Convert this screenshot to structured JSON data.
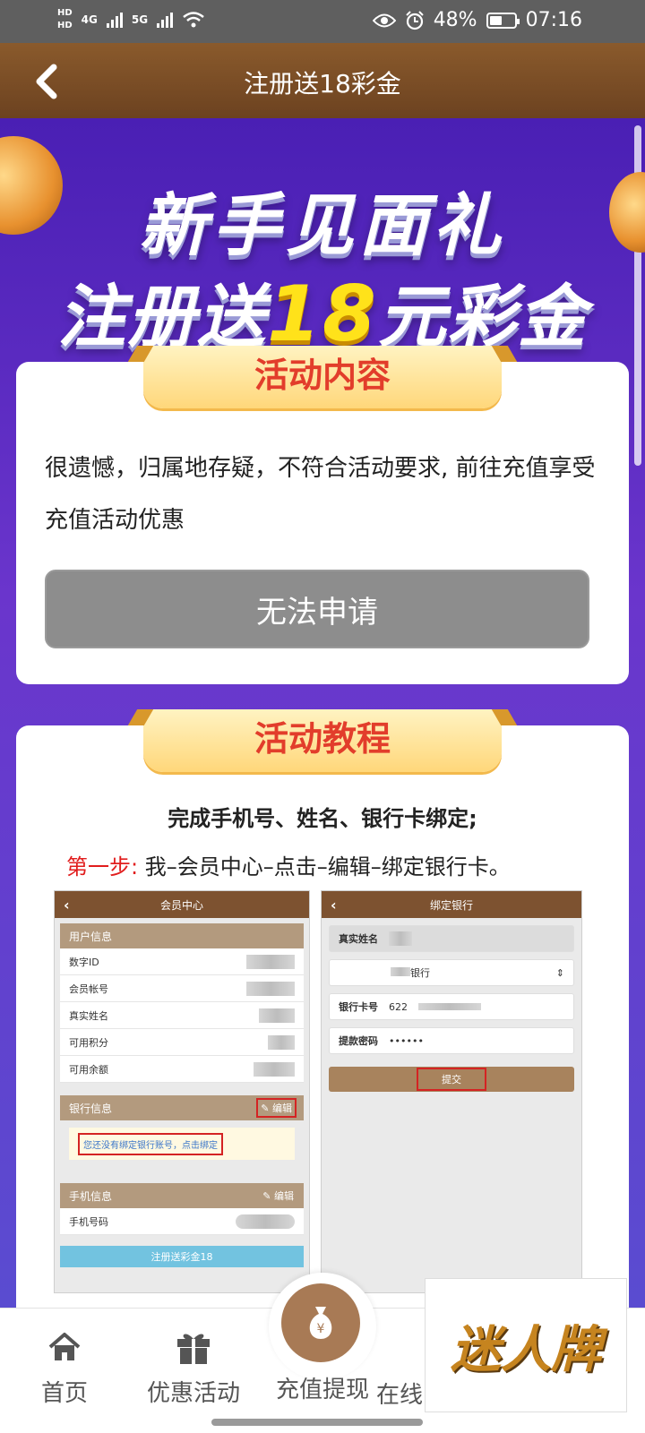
{
  "status_bar": {
    "network_hd_1": "HD",
    "network_hd_2": "HD",
    "network_4g": "4G",
    "network_5g": "5G",
    "battery": "48%",
    "time": "07:16"
  },
  "nav": {
    "title": "注册送18彩金"
  },
  "hero": {
    "line1": "新手见面礼",
    "line2_prefix": "注册送",
    "line2_amount": "18",
    "line2_suffix": "元彩金"
  },
  "activity": {
    "ribbon": "活动内容",
    "text": "很遗憾，归属地存疑，不符合活动要求, 前往充值享受充值活动优惠",
    "button": "无法申请"
  },
  "tutorial": {
    "ribbon": "活动教程",
    "heading": "完成手机号、姓名、银行卡绑定;",
    "step_label": "第一步:",
    "step_text": "我–会员中心–点击–编辑–绑定银行卡。",
    "left_shot": {
      "title": "会员中心",
      "user_section": "用户信息",
      "rows": [
        "数字ID",
        "会员帐号",
        "真实姓名",
        "可用积分",
        "可用余额"
      ],
      "bank_section": "银行信息",
      "edit": "编辑",
      "bind_prompt": "您还没有绑定银行账号，点击绑定",
      "phone_section": "手机信息",
      "phone_row": "手机号码",
      "bottom_button": "注册送彩金18"
    },
    "right_shot": {
      "title": "绑定银行",
      "name_label": "真实姓名",
      "bank_select": "银行",
      "card_label": "银行卡号",
      "card_value": "622",
      "pwd_label": "提款密码",
      "pwd_value": "••••••",
      "submit": "提交"
    }
  },
  "tabbar": {
    "home": "首页",
    "promo": "优惠活动",
    "recharge": "充值提现",
    "online": "在线",
    "watermark": "迷人牌"
  }
}
